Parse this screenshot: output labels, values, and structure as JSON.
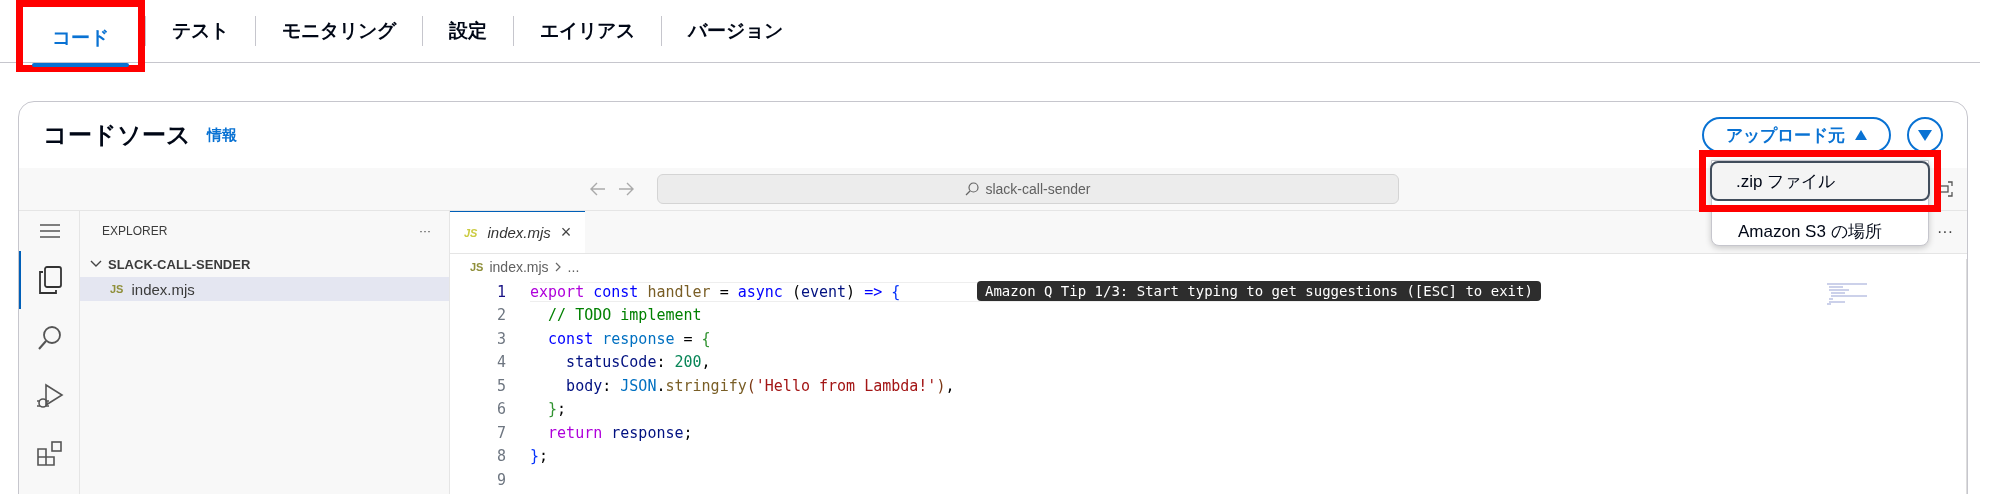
{
  "tabs": [
    {
      "label": "コード",
      "selected": true,
      "highlighted": true
    },
    {
      "label": "テスト",
      "selected": false,
      "highlighted": false
    },
    {
      "label": "モニタリング",
      "selected": false,
      "highlighted": false
    },
    {
      "label": "設定",
      "selected": false,
      "highlighted": false
    },
    {
      "label": "エイリアス",
      "selected": false,
      "highlighted": false
    },
    {
      "label": "バージョン",
      "selected": false,
      "highlighted": false
    }
  ],
  "code_source": {
    "title": "コードソース",
    "info_link": "情報",
    "upload_button": {
      "label": "アップロード元",
      "expanded": true
    },
    "upload_menu": [
      {
        "label": ".zip ファイル",
        "selected": true,
        "highlighted": true
      },
      {
        "label": "Amazon S3 の場所",
        "selected": false,
        "highlighted": false
      }
    ],
    "ide": {
      "search": {
        "value": "slack-call-sender"
      },
      "activity_bar": [
        {
          "kind": "menu",
          "selected": false
        },
        {
          "kind": "files",
          "selected": true
        },
        {
          "kind": "search",
          "selected": false
        },
        {
          "kind": "run",
          "selected": false
        },
        {
          "kind": "extensions",
          "selected": false
        }
      ],
      "explorer": {
        "title": "EXPLORER",
        "more": "···",
        "folder": {
          "label": "SLACK-CALL-SENDER",
          "expanded": true,
          "children": [
            {
              "label": "index.mjs",
              "badge": "JS",
              "selected": true
            }
          ]
        }
      },
      "editor_tab": {
        "label": "index.mjs",
        "badge": "JS",
        "close": "×"
      },
      "editor_more": "···",
      "breadcrumb": {
        "badge": "JS",
        "file": "index.mjs",
        "rest": "..."
      },
      "tooltip": "Amazon Q Tip 1/3: Start typing to get suggestions ([ESC] to exit)",
      "lines": [
        {
          "number": "1",
          "current": true,
          "tokens": [
            {
              "text": "export",
              "kind": "control"
            },
            {
              "text": " const",
              "kind": "storage"
            },
            {
              "text": " handler",
              "kind": "func"
            },
            {
              "text": " = ",
              "kind": "plain"
            },
            {
              "text": "async",
              "kind": "storage"
            },
            {
              "text": " (",
              "kind": "plain"
            },
            {
              "text": "event",
              "kind": "var"
            },
            {
              "text": ") ",
              "kind": "plain"
            },
            {
              "text": "=>",
              "kind": "storage"
            },
            {
              "text": " {",
              "kind": "bracket1"
            }
          ]
        },
        {
          "number": "2",
          "current": false,
          "tokens": [
            {
              "text": "  // TODO implement",
              "kind": "comment"
            }
          ]
        },
        {
          "number": "3",
          "current": false,
          "tokens": [
            {
              "text": "  const",
              "kind": "storage"
            },
            {
              "text": " response",
              "kind": "const"
            },
            {
              "text": " = ",
              "kind": "plain"
            },
            {
              "text": "{",
              "kind": "bracket2"
            }
          ]
        },
        {
          "number": "4",
          "current": false,
          "tokens": [
            {
              "text": "    statusCode",
              "kind": "var"
            },
            {
              "text": ": ",
              "kind": "plain"
            },
            {
              "text": "200",
              "kind": "num"
            },
            {
              "text": ",",
              "kind": "plain"
            }
          ]
        },
        {
          "number": "5",
          "current": false,
          "tokens": [
            {
              "text": "    body",
              "kind": "var"
            },
            {
              "text": ": ",
              "kind": "plain"
            },
            {
              "text": "JSON",
              "kind": "const"
            },
            {
              "text": ".",
              "kind": "plain"
            },
            {
              "text": "stringify",
              "kind": "func"
            },
            {
              "text": "(",
              "kind": "bracket3"
            },
            {
              "text": "'Hello from Lambda!'",
              "kind": "str"
            },
            {
              "text": ")",
              "kind": "bracket3"
            },
            {
              "text": ",",
              "kind": "plain"
            }
          ]
        },
        {
          "number": "6",
          "current": false,
          "tokens": [
            {
              "text": "  }",
              "kind": "bracket2"
            },
            {
              "text": ";",
              "kind": "plain"
            }
          ]
        },
        {
          "number": "7",
          "current": false,
          "tokens": [
            {
              "text": "  return",
              "kind": "control"
            },
            {
              "text": " response",
              "kind": "var"
            },
            {
              "text": ";",
              "kind": "plain"
            }
          ]
        },
        {
          "number": "8",
          "current": false,
          "tokens": [
            {
              "text": "}",
              "kind": "bracket1"
            },
            {
              "text": ";",
              "kind": "plain"
            }
          ]
        },
        {
          "number": "9",
          "current": false
        }
      ]
    }
  }
}
